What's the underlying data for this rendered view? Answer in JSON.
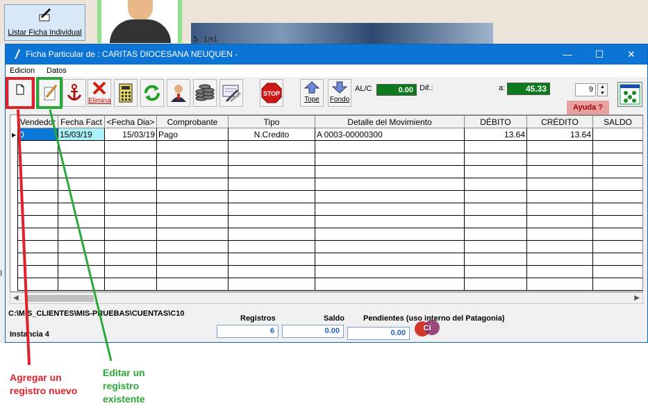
{
  "background": {
    "listar_button_label": "Listar Ficha Individual",
    "fragment_text": "5 ini"
  },
  "window": {
    "title": "Ficha Particular de : CARITAS DIOCESANA NEUQUEN -",
    "minimize_glyph": "—",
    "maximize_glyph": "☐",
    "close_glyph": "✕"
  },
  "menu": {
    "items": [
      {
        "label": "Edicion"
      },
      {
        "label": "Datos"
      }
    ]
  },
  "toolbar": {
    "elimina_label": "Elimina",
    "tope_label": "Tope",
    "fondo_label": "Fondo",
    "alc_label": "AL/C",
    "alc_value": "0.00",
    "dif_label": "Dif.:",
    "a_label": "a:",
    "a_value": "45.33",
    "spin_value": "9",
    "ayuda_label": "Ayuda ?"
  },
  "grid": {
    "columns": [
      "Vendedor",
      "Fecha Fact",
      "<Fecha Dia>",
      "Comprobante",
      "Tipo",
      "Detalle del Movimiento",
      "DÉBITO",
      "CRÉDITO",
      "SALDO"
    ],
    "rows": [
      {
        "vendedor": "0",
        "fecha_fact": "15/03/19",
        "fecha_dia": "15/03/19",
        "comprobante": "Pago",
        "tipo": "N.Credito",
        "detalle": "A 0003-00000300",
        "debito": "13.64",
        "credito": "13.64",
        "saldo": ""
      }
    ]
  },
  "status": {
    "path": "C:\\MIS_CLIENTES\\MIS-PRUEBAS\\CUENTAS\\C10",
    "instancia": "Instancia 4",
    "registros_label": "Registros",
    "registros_value": "6",
    "saldo_label": "Saldo",
    "saldo_value": "0.00",
    "pendientes_label": "Pendientes (uso interno del Patagonia)",
    "pendientes_value": "0.00"
  },
  "annotations": {
    "red_line1": "Agregar un",
    "red_line2": "registro nuevo",
    "green_line1": "Editar un",
    "green_line2": "registro",
    "green_line3": "existente",
    "red_color": "#e0202a",
    "green_color": "#28a838"
  }
}
